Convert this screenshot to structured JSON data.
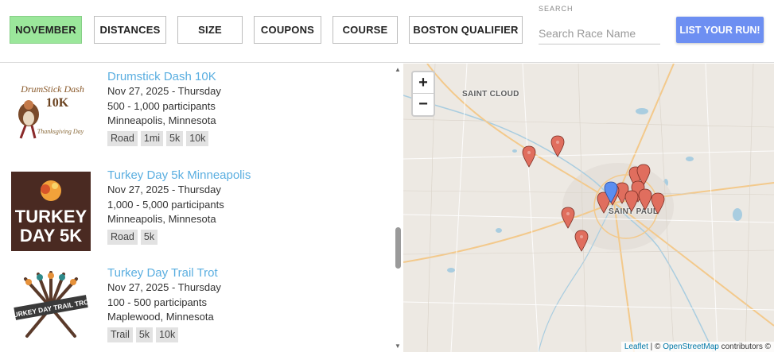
{
  "filters": {
    "november": "NOVEMBER",
    "distances": "DISTANCES",
    "size": "SIZE",
    "coupons": "COUPONS",
    "course": "COURSE",
    "boston": "BOSTON QUALIFIER"
  },
  "search": {
    "label": "SEARCH",
    "placeholder": "Search Race Name"
  },
  "list_run": "LIST YOUR RUN!",
  "races": [
    {
      "title": "Drumstick Dash 10K",
      "date": "Nov 27, 2025 - Thursday",
      "participants": "500 - 1,000 participants",
      "location": "Minneapolis, Minnesota",
      "tags": [
        "Road",
        "1mi",
        "5k",
        "10k"
      ],
      "logo_lines": [
        "DrumStick Dash",
        "10K",
        "Thanksgiving Day"
      ]
    },
    {
      "title": "Turkey Day 5k Minneapolis",
      "date": "Nov 27, 2025 - Thursday",
      "participants": "1,000 - 5,000 participants",
      "location": "Minneapolis, Minnesota",
      "tags": [
        "Road",
        "5k"
      ],
      "logo_lines": [
        "TURKEY",
        "DAY 5K"
      ]
    },
    {
      "title": "Turkey Day Trail Trot",
      "date": "Nov 27, 2025 - Thursday",
      "participants": "100 - 500 participants",
      "location": "Maplewood, Minnesota",
      "tags": [
        "Trail",
        "5k",
        "10k"
      ],
      "logo_lines": [
        "TURKEY DAY TRAIL TROT"
      ]
    }
  ],
  "map": {
    "zoom_in": "+",
    "zoom_out": "−",
    "cities": [
      "SAINT CLOUD",
      "SAINT PAUL"
    ],
    "attribution": {
      "leaflet": "Leaflet",
      "sep": " | © ",
      "osm": "OpenStreetMap",
      "rest": " contributors ©"
    },
    "marker_color": "#e06e5e",
    "selected_marker_color": "#5b8ef0"
  }
}
